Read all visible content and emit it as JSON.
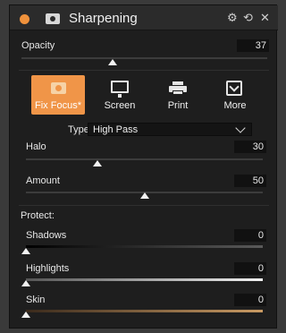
{
  "panel": {
    "title": "Sharpening",
    "accent_color": "#f09548",
    "status_dot_color": "#f0923c",
    "header_icons": [
      "gear-icon",
      "reset-icon",
      "close-icon"
    ],
    "header_glyphs": {
      "gear": "⚙",
      "reset": "⟲",
      "close": "✕"
    }
  },
  "opacity": {
    "label": "Opacity",
    "value": "37",
    "level": 0.37
  },
  "presets": [
    {
      "label": "Fix Focus*",
      "active": true,
      "icon": "camera-icon"
    },
    {
      "label": "Screen",
      "active": false,
      "icon": "monitor-icon"
    },
    {
      "label": "Print",
      "active": false,
      "icon": "printer-icon"
    },
    {
      "label": "More",
      "active": false,
      "icon": "more-dropdown-icon"
    }
  ],
  "type": {
    "label": "Type",
    "value": "High Pass"
  },
  "halo": {
    "label": "Halo",
    "value": "30",
    "level": 0.3
  },
  "amount": {
    "label": "Amount",
    "value": "50",
    "level": 0.5
  },
  "protect": {
    "heading": "Protect:",
    "shadows": {
      "label": "Shadows",
      "value": "0",
      "level": 0
    },
    "highlights": {
      "label": "Highlights",
      "value": "0",
      "level": 0
    },
    "skin": {
      "label": "Skin",
      "value": "0",
      "level": 0
    }
  }
}
